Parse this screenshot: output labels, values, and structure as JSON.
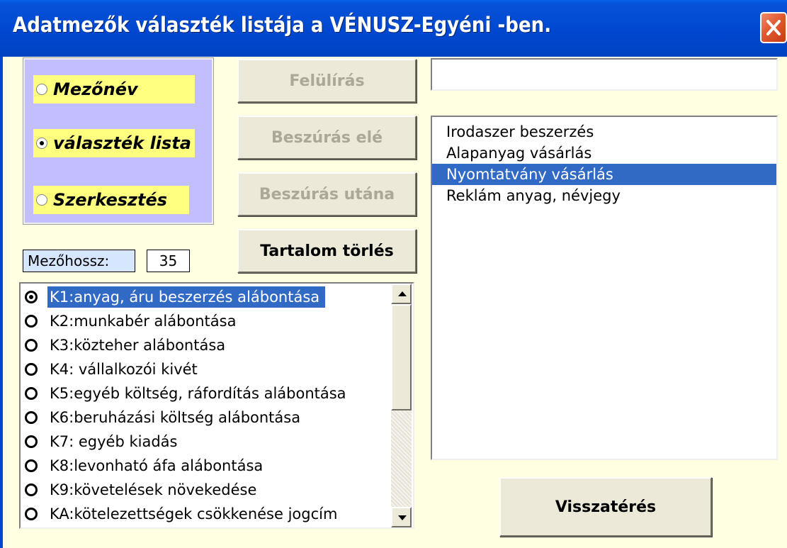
{
  "window": {
    "title": "Adatmezők választék listája a VÉNUSZ-Egyéni -ben."
  },
  "mode_options": [
    {
      "label": "Mezőnév",
      "selected": false
    },
    {
      "label": "választék lista",
      "selected": true
    },
    {
      "label": "Szerkesztés",
      "selected": false
    }
  ],
  "buttons": {
    "overwrite": "Felülírás",
    "insert_before": "Beszúrás elé",
    "insert_after": "Beszúrás utána",
    "clear_content": "Tartalom törlés",
    "back": "Visszatérés"
  },
  "field_length": {
    "label": "Mezőhossz:",
    "value": "35"
  },
  "top_input": {
    "value": ""
  },
  "choice_list": {
    "items": [
      "Irodaszer beszerzés",
      "Alapanyag vásárlás",
      "Nyomtatvány vásárlás",
      "Reklám anyag, névjegy"
    ],
    "selected": "Nyomtatvány vásárlás"
  },
  "field_list": {
    "items": [
      "K1:anyag, áru beszerzés alábontása",
      "K2:munkabér alábontása",
      "K3:közteher alábontása",
      "K4: vállalkozói kivét",
      "K5:egyéb költség, ráfordítás alábontása",
      "K6:beruházási költség alábontása",
      "K7: egyéb kiadás",
      "K8:levonható áfa alábontása",
      "K9:követelések növekedése",
      "KA:kötelezettségek csökkenése jogcím"
    ],
    "selected": "K1:anyag, áru beszerzés alábontása"
  },
  "colors": {
    "titlebar": "#0047d0",
    "selection": "#316ac5",
    "panel_bg": "#c3bfff",
    "option_bg": "#ffff7f",
    "dialog_bg": "#ffffe1"
  }
}
